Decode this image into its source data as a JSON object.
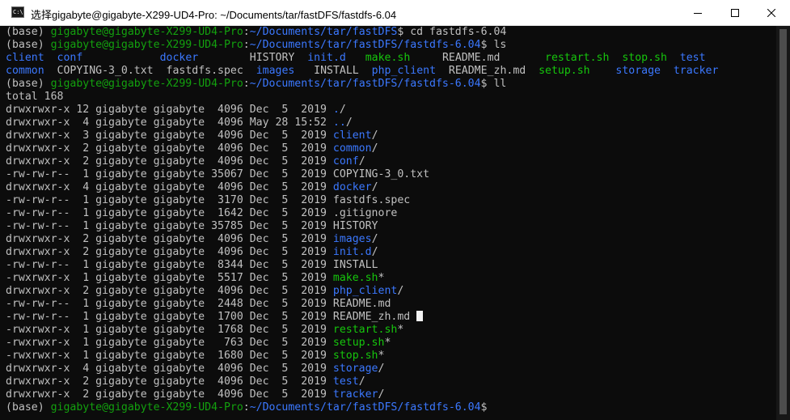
{
  "window": {
    "title": "选择gigabyte@gigabyte-X299-UD4-Pro: ~/Documents/tar/fastDFS/fastdfs-6.04",
    "app_icon_text": "C:\\",
    "icons": {
      "app": "terminal-icon",
      "minimize": "minimize-icon",
      "maximize": "maximize-icon",
      "close": "close-icon"
    }
  },
  "prompt": {
    "env": "(base) ",
    "user_host": "gigabyte@gigabyte-X299-UD4-Pro",
    "colon": ":",
    "dir1": "~/Documents/tar/fastDFS",
    "dir2": "~/Documents/tar/fastDFS/fastdfs-6.04",
    "dollar": "$ "
  },
  "commands": {
    "cd": "cd fastdfs-6.04",
    "ls": "ls",
    "ll": "ll"
  },
  "ls_output": [
    [
      {
        "t": "client",
        "c": "b"
      },
      {
        "t": "  "
      },
      {
        "t": "conf",
        "c": "b"
      },
      {
        "t": "            "
      },
      {
        "t": "docker",
        "c": "b"
      },
      {
        "t": "        "
      },
      {
        "t": "HISTORY"
      },
      {
        "t": "  "
      },
      {
        "t": "init.d",
        "c": "b"
      },
      {
        "t": "   "
      },
      {
        "t": "make.sh",
        "c": "lg"
      },
      {
        "t": "     "
      },
      {
        "t": "README.md"
      },
      {
        "t": "       "
      },
      {
        "t": "restart.sh",
        "c": "lg"
      },
      {
        "t": "  "
      },
      {
        "t": "stop.sh",
        "c": "lg"
      },
      {
        "t": "  "
      },
      {
        "t": "test",
        "c": "b"
      }
    ],
    [
      {
        "t": "common",
        "c": "b"
      },
      {
        "t": "  "
      },
      {
        "t": "COPYING-3_0.txt"
      },
      {
        "t": "  "
      },
      {
        "t": "fastdfs.spec"
      },
      {
        "t": "  "
      },
      {
        "t": "images",
        "c": "b"
      },
      {
        "t": "   "
      },
      {
        "t": "INSTALL"
      },
      {
        "t": "  "
      },
      {
        "t": "php_client",
        "c": "b"
      },
      {
        "t": "  "
      },
      {
        "t": "README_zh.md"
      },
      {
        "t": "  "
      },
      {
        "t": "setup.sh",
        "c": "lg"
      },
      {
        "t": "    "
      },
      {
        "t": "storage",
        "c": "b"
      },
      {
        "t": "  "
      },
      {
        "t": "tracker",
        "c": "b"
      }
    ]
  ],
  "total": "total 168",
  "ll_rows": [
    {
      "perm": "drwxrwxr-x",
      "links": "12",
      "owner": "gigabyte",
      "group": "gigabyte",
      "size": " 4096",
      "date": "Dec  5  2019",
      "name": "./",
      "kind": "dir"
    },
    {
      "perm": "drwxrwxr-x",
      "links": " 4",
      "owner": "gigabyte",
      "group": "gigabyte",
      "size": " 4096",
      "date": "May 28 15:52",
      "name": "../",
      "kind": "dir"
    },
    {
      "perm": "drwxrwxr-x",
      "links": " 3",
      "owner": "gigabyte",
      "group": "gigabyte",
      "size": " 4096",
      "date": "Dec  5  2019",
      "name": "client/",
      "kind": "dir"
    },
    {
      "perm": "drwxrwxr-x",
      "links": " 2",
      "owner": "gigabyte",
      "group": "gigabyte",
      "size": " 4096",
      "date": "Dec  5  2019",
      "name": "common/",
      "kind": "dir"
    },
    {
      "perm": "drwxrwxr-x",
      "links": " 2",
      "owner": "gigabyte",
      "group": "gigabyte",
      "size": " 4096",
      "date": "Dec  5  2019",
      "name": "conf/",
      "kind": "dir"
    },
    {
      "perm": "-rw-rw-r--",
      "links": " 1",
      "owner": "gigabyte",
      "group": "gigabyte",
      "size": "35067",
      "date": "Dec  5  2019",
      "name": "COPYING-3_0.txt",
      "kind": "file"
    },
    {
      "perm": "drwxrwxr-x",
      "links": " 4",
      "owner": "gigabyte",
      "group": "gigabyte",
      "size": " 4096",
      "date": "Dec  5  2019",
      "name": "docker/",
      "kind": "dir"
    },
    {
      "perm": "-rw-rw-r--",
      "links": " 1",
      "owner": "gigabyte",
      "group": "gigabyte",
      "size": " 3170",
      "date": "Dec  5  2019",
      "name": "fastdfs.spec",
      "kind": "file"
    },
    {
      "perm": "-rw-rw-r--",
      "links": " 1",
      "owner": "gigabyte",
      "group": "gigabyte",
      "size": " 1642",
      "date": "Dec  5  2019",
      "name": ".gitignore",
      "kind": "file"
    },
    {
      "perm": "-rw-rw-r--",
      "links": " 1",
      "owner": "gigabyte",
      "group": "gigabyte",
      "size": "35785",
      "date": "Dec  5  2019",
      "name": "HISTORY",
      "kind": "file"
    },
    {
      "perm": "drwxrwxr-x",
      "links": " 2",
      "owner": "gigabyte",
      "group": "gigabyte",
      "size": " 4096",
      "date": "Dec  5  2019",
      "name": "images/",
      "kind": "dir"
    },
    {
      "perm": "drwxrwxr-x",
      "links": " 2",
      "owner": "gigabyte",
      "group": "gigabyte",
      "size": " 4096",
      "date": "Dec  5  2019",
      "name": "init.d/",
      "kind": "dir"
    },
    {
      "perm": "-rw-rw-r--",
      "links": " 1",
      "owner": "gigabyte",
      "group": "gigabyte",
      "size": " 8344",
      "date": "Dec  5  2019",
      "name": "INSTALL",
      "kind": "file"
    },
    {
      "perm": "-rwxrwxr-x",
      "links": " 1",
      "owner": "gigabyte",
      "group": "gigabyte",
      "size": " 5517",
      "date": "Dec  5  2019",
      "name": "make.sh*",
      "kind": "exec"
    },
    {
      "perm": "drwxrwxr-x",
      "links": " 2",
      "owner": "gigabyte",
      "group": "gigabyte",
      "size": " 4096",
      "date": "Dec  5  2019",
      "name": "php_client/",
      "kind": "dir"
    },
    {
      "perm": "-rw-rw-r--",
      "links": " 1",
      "owner": "gigabyte",
      "group": "gigabyte",
      "size": " 2448",
      "date": "Dec  5  2019",
      "name": "README.md",
      "kind": "file"
    },
    {
      "perm": "-rw-rw-r--",
      "links": " 1",
      "owner": "gigabyte",
      "group": "gigabyte",
      "size": " 1700",
      "date": "Dec  5  2019",
      "name": "README_zh.md ",
      "kind": "file",
      "cursor": true
    },
    {
      "perm": "-rwxrwxr-x",
      "links": " 1",
      "owner": "gigabyte",
      "group": "gigabyte",
      "size": " 1768",
      "date": "Dec  5  2019",
      "name": "restart.sh*",
      "kind": "exec"
    },
    {
      "perm": "-rwxrwxr-x",
      "links": " 1",
      "owner": "gigabyte",
      "group": "gigabyte",
      "size": "  763",
      "date": "Dec  5  2019",
      "name": "setup.sh*",
      "kind": "exec"
    },
    {
      "perm": "-rwxrwxr-x",
      "links": " 1",
      "owner": "gigabyte",
      "group": "gigabyte",
      "size": " 1680",
      "date": "Dec  5  2019",
      "name": "stop.sh*",
      "kind": "exec"
    },
    {
      "perm": "drwxrwxr-x",
      "links": " 4",
      "owner": "gigabyte",
      "group": "gigabyte",
      "size": " 4096",
      "date": "Dec  5  2019",
      "name": "storage/",
      "kind": "dir"
    },
    {
      "perm": "drwxrwxr-x",
      "links": " 2",
      "owner": "gigabyte",
      "group": "gigabyte",
      "size": " 4096",
      "date": "Dec  5  2019",
      "name": "test/",
      "kind": "dir"
    },
    {
      "perm": "drwxrwxr-x",
      "links": " 2",
      "owner": "gigabyte",
      "group": "gigabyte",
      "size": " 4096",
      "date": "Dec  5  2019",
      "name": "tracker/",
      "kind": "dir"
    }
  ],
  "colors": {
    "background": "#0c0c0c",
    "text": "#c0c0c0",
    "prompt_user": "#13a10e",
    "directory": "#3b78ff",
    "executable": "#16c60c",
    "cursor": "#f2f2f2"
  }
}
